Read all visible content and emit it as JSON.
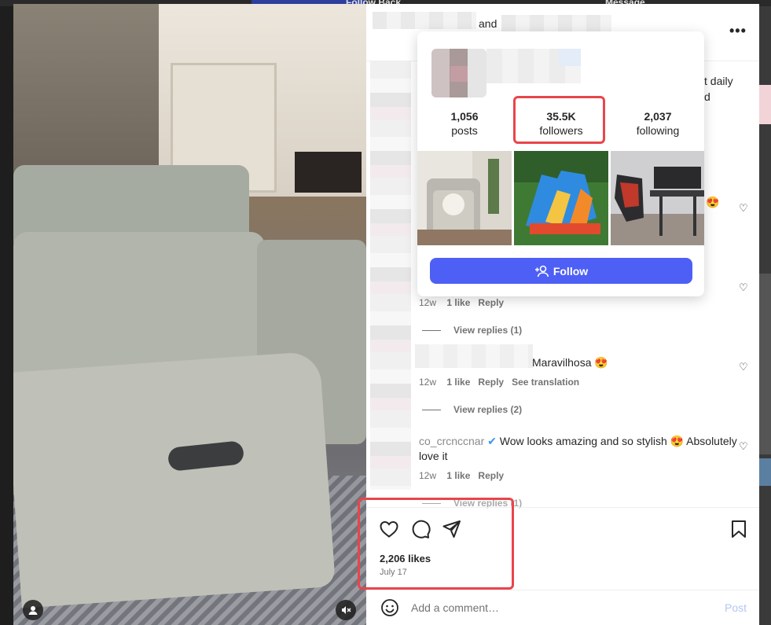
{
  "background": {
    "top_left_text": "Follow Back",
    "top_right_text": "Message"
  },
  "post_header": {
    "and_text": "and",
    "more_icon": "more-horizontal-icon"
  },
  "caption_fragments": {
    "line1": "t daily",
    "line2": "d"
  },
  "hover_card": {
    "stats": [
      {
        "value": "1,056",
        "label": "posts"
      },
      {
        "value": "35.5K",
        "label": "followers"
      },
      {
        "value": "2,037",
        "label": "following"
      }
    ],
    "follow_label": "Follow"
  },
  "comments": [
    {
      "time": "12w",
      "likes": "1 like",
      "reply": "Reply",
      "view_replies": "View replies (1)"
    },
    {
      "text": "Maravilhosa 😍",
      "time": "12w",
      "likes": "1 like",
      "reply": "Reply",
      "translation": "See translation",
      "view_replies": "View replies (2)"
    },
    {
      "text": "Wow looks amazing and so stylish 😍 Absolutely love it",
      "username_fragment": "co_crcnccnar",
      "time": "12w",
      "likes": "1 like",
      "reply": "Reply",
      "view_replies": "View replies (1)"
    }
  ],
  "emoji_fragment": "😍",
  "actions": {
    "likes": "2,206 likes",
    "date": "July 17"
  },
  "comment_bar": {
    "placeholder": "Add a comment…",
    "post_label": "Post"
  },
  "colors": {
    "follow_button": "#4e5ff6",
    "highlight_red": "#e8454b"
  }
}
